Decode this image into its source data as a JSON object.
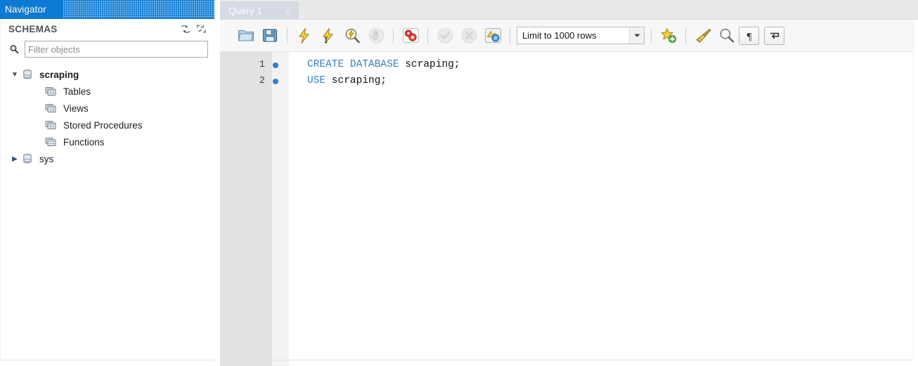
{
  "navigator": {
    "title": "Navigator",
    "section_label": "SCHEMAS",
    "header_icons": [
      {
        "name": "refresh-icon",
        "label": "Refresh"
      },
      {
        "name": "collapse-all-icon",
        "label": "Collapse All"
      }
    ],
    "filter": {
      "placeholder": "Filter objects",
      "value": "",
      "icon": "search-icon"
    },
    "tree": [
      {
        "label": "scraping",
        "icon": "database-icon",
        "expanded": true,
        "bold": true,
        "twisty": "▼",
        "children": [
          {
            "label": "Tables",
            "icon": "table-folder-icon"
          },
          {
            "label": "Views",
            "icon": "table-folder-icon"
          },
          {
            "label": "Stored Procedures",
            "icon": "table-folder-icon"
          },
          {
            "label": "Functions",
            "icon": "table-folder-icon"
          }
        ]
      },
      {
        "label": "sys",
        "icon": "database-icon",
        "expanded": false,
        "bold": false,
        "twisty": "▶",
        "children": []
      }
    ]
  },
  "query_panel": {
    "tab": {
      "label": "Query 1",
      "close_label": "×"
    },
    "toolbar": {
      "buttons": [
        {
          "name": "open-sql-file-icon",
          "title": "Open a SQL script file in a new query tab",
          "enabled": true
        },
        {
          "name": "save-script-icon",
          "title": "Save the script to a file",
          "enabled": true
        },
        {
          "name": "execute-statement-icon",
          "title": "Execute the selected portion of the script",
          "enabled": true
        },
        {
          "name": "execute-current-statement-icon",
          "title": "Execute the statement under the keyboard cursor",
          "enabled": true
        },
        {
          "name": "explain-statement-icon",
          "title": "Execute the EXPLAIN command on the statement under the cursor",
          "enabled": true
        },
        {
          "name": "stop-execution-icon",
          "title": "Stop the query being executed",
          "enabled": false
        },
        {
          "name": "toggle-stop-on-error-icon",
          "title": "Toggle whether execution should stop or continue if errors occur",
          "enabled": true
        },
        {
          "name": "commit-transaction-icon",
          "title": "Commit the current transaction",
          "enabled": false
        },
        {
          "name": "rollback-transaction-icon",
          "title": "Rollback the current transaction",
          "enabled": false
        },
        {
          "name": "toggle-autocommit-icon",
          "title": "Toggle autocommit mode",
          "enabled": true
        },
        {
          "name": "save-snippet-icon",
          "title": "Save current statement or selection to the snippet list",
          "enabled": true
        },
        {
          "name": "beautify-query-icon",
          "title": "Beautify/reformat the SQL script",
          "enabled": true
        },
        {
          "name": "find-icon",
          "title": "Show the Find panel for the editor",
          "enabled": true
        },
        {
          "name": "toggle-invisible-chars-icon",
          "title": "Toggle invisible characters",
          "enabled": true
        },
        {
          "name": "toggle-wrapping-icon",
          "title": "Toggle wrapping of long lines",
          "enabled": true
        }
      ],
      "row_limit": {
        "value": "Limit to 1000 rows",
        "arrow": "▾"
      }
    },
    "editor": {
      "lines": [
        {
          "number": "1",
          "has_bookmark": true,
          "tokens": [
            {
              "text": "CREATE DATABASE",
              "type": "keyword"
            },
            {
              "text": " scraping;",
              "type": "plain"
            }
          ]
        },
        {
          "number": "2",
          "has_bookmark": true,
          "tokens": [
            {
              "text": "USE",
              "type": "keyword"
            },
            {
              "text": " scraping;",
              "type": "plain"
            }
          ]
        }
      ]
    }
  },
  "colors": {
    "navigator_title_bg": "#0d7bd4",
    "keyword": "#3a7fc1",
    "bookmark_dot": "#2f7fd8",
    "tab_bg": "#d6dae2",
    "gutter_bg": "#e2e2e2"
  }
}
